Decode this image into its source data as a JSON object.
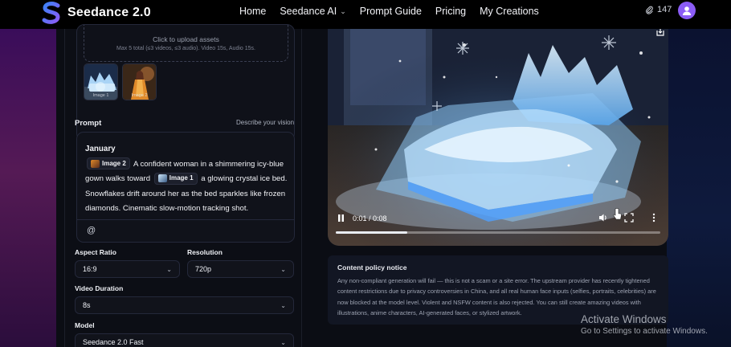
{
  "app": {
    "brand": "Seedance 2.0",
    "accent": "#7c3aed"
  },
  "nav": {
    "items": [
      {
        "label": "Home"
      },
      {
        "label": "Seedance AI",
        "has_dropdown": true
      },
      {
        "label": "Prompt Guide"
      },
      {
        "label": "Pricing"
      },
      {
        "label": "My Creations"
      }
    ],
    "credits": "147",
    "credits_icon": "paperclip-icon",
    "avatar_icon": "user-icon"
  },
  "upload": {
    "title": "Click to upload assets",
    "subtitle": "Max 5 total (≤3 videos, ≤3 audio). Video 15s, Audio 15s.",
    "thumbnails": [
      {
        "caption": "Image 1"
      },
      {
        "caption": "Image 2"
      }
    ]
  },
  "prompt": {
    "label": "Prompt",
    "hint": "Describe your vision",
    "title": "January",
    "chip1": "Image 2",
    "text1": "A confident woman in a shimmering icy-blue gown walks toward",
    "chip2": "Image 1",
    "text2": "a glowing crystal ice bed. Snowflakes drift around her as the bed sparkles like frozen diamonds. Cinematic slow-motion tracking shot.",
    "mention_symbol": "@"
  },
  "settings": {
    "aspect_ratio": {
      "label": "Aspect Ratio",
      "value": "16:9"
    },
    "resolution": {
      "label": "Resolution",
      "value": "720p"
    },
    "duration": {
      "label": "Video Duration",
      "value": "8s"
    },
    "model": {
      "label": "Model",
      "value": "Seedance 2.0 Fast"
    }
  },
  "player": {
    "time": "0:01 / 0:08",
    "progress": 0.22
  },
  "notice": {
    "title": "Content policy notice",
    "body": "Any non-compliant generation will fail — this is not a scam or a site error. The upstream provider has recently tightened content restrictions due to privacy controversies in China, and all real human face inputs (selfies, portraits, celebrities) are now blocked at the model level. Violent and NSFW content is also rejected. You can still create amazing videos with illustrations, anime characters, AI-generated faces, or stylized artwork."
  },
  "watermark": {
    "line1": "Activate Windows",
    "line2": "Go to Settings to activate Windows."
  }
}
